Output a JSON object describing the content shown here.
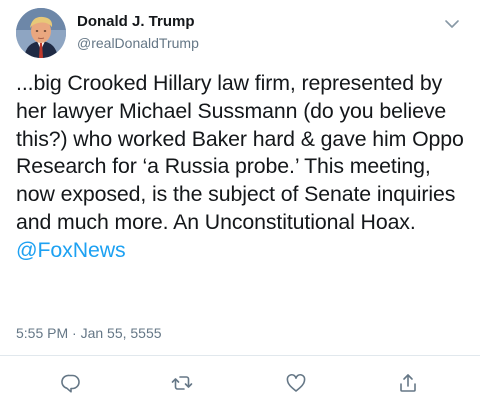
{
  "tweet": {
    "display_name": "Donald J. Trump",
    "handle": "@realDonaldTrump",
    "text": "...big Crooked Hillary law firm, represented by her lawyer Michael Sussmann (do you believe this?) who worked Baker hard & gave him Oppo Research for ‘a Russia probe.’ This meeting, now exposed, is the subject of Senate inquiries and much more. An Unconstitutional Hoax. ",
    "mention": "@FoxNews",
    "timestamp": "5:55 PM · Jan 55, 5555"
  },
  "colors": {
    "text": "#14171a",
    "secondary": "#657786",
    "link": "#1da1f2",
    "divider": "#e1e8ed"
  },
  "icons": {
    "menu": "chevron-down-icon",
    "reply": "reply-icon",
    "retweet": "retweet-icon",
    "like": "heart-icon",
    "share": "share-icon"
  }
}
